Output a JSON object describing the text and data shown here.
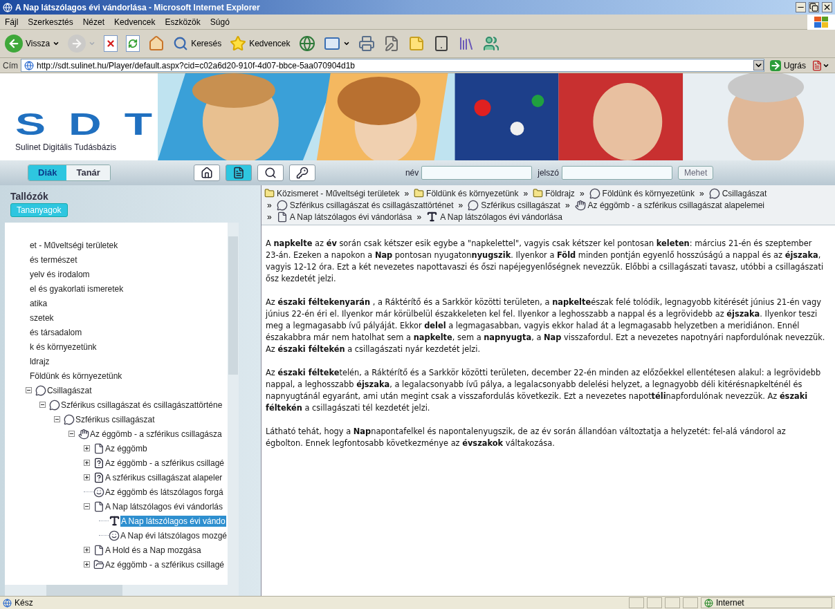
{
  "window": {
    "title": "A Nap látszólagos évi vándorlása - Microsoft Internet Explorer"
  },
  "menu": [
    "Fájl",
    "Szerkesztés",
    "Nézet",
    "Kedvencek",
    "Eszközök",
    "Súgó"
  ],
  "toolbar": [
    {
      "kind": "back",
      "label": "Vissza",
      "dropdown": true,
      "disabled": false
    },
    {
      "kind": "forward",
      "dropdown": true,
      "disabled": true
    },
    {
      "kind": "stop",
      "dropdown": false,
      "disabled": false
    },
    {
      "kind": "refresh",
      "dropdown": false,
      "disabled": false
    },
    {
      "kind": "home",
      "dropdown": false,
      "disabled": false
    },
    {
      "kind": "search",
      "label": "Keresés",
      "dropdown": false,
      "disabled": false
    },
    {
      "kind": "favorites",
      "label": "Kedvencek",
      "dropdown": false,
      "disabled": false
    },
    {
      "kind": "media",
      "dropdown": false,
      "disabled": false
    },
    {
      "kind": "mail",
      "dropdown": true,
      "disabled": false
    },
    {
      "kind": "print",
      "dropdown": false,
      "disabled": false
    },
    {
      "kind": "edit",
      "dropdown": false,
      "disabled": false
    },
    {
      "kind": "note",
      "dropdown": false,
      "disabled": false
    },
    {
      "kind": "device",
      "dropdown": false,
      "disabled": false
    },
    {
      "kind": "research",
      "dropdown": false,
      "disabled": false
    },
    {
      "kind": "messenger",
      "dropdown": false,
      "disabled": false
    }
  ],
  "address": {
    "label": "Cím",
    "value": "http://sdt.sulinet.hu/Player/default.aspx?cid=c02a6d20-910f-4d07-bbce-5aa070904d1b",
    "go": "Ugrás"
  },
  "banner": {
    "logo": "SDT",
    "subtitle": "Sulinet Digitális Tudásbázis",
    "kind": "picture"
  },
  "nav": {
    "roles": [
      {
        "label": "Diák",
        "selected": true
      },
      {
        "label": "Tanár",
        "selected": false
      }
    ],
    "tools": [
      {
        "kind": "home",
        "selected": false
      },
      {
        "kind": "page",
        "selected": true
      },
      {
        "kind": "search",
        "selected": false
      },
      {
        "kind": "key",
        "selected": false
      }
    ],
    "login": {
      "name_label": "név",
      "password_label": "jelszó",
      "submit": "Mehet"
    }
  },
  "sidebar": {
    "title": "Tallózók",
    "tab": "Tananyagok",
    "tree": [
      {
        "label": "et - Műveltségi területek",
        "selected": false,
        "children": [
          {
            "label": "és természet",
            "selected": false
          },
          {
            "label": "yelv és irodalom",
            "selected": false
          },
          {
            "label": "el és gyakorlati ismeretek",
            "selected": false
          },
          {
            "label": "atika",
            "selected": false
          },
          {
            "label": "szetek",
            "selected": false
          },
          {
            "label": "és társadalom",
            "selected": false
          },
          {
            "label": "k és környezetünk",
            "selected": false,
            "children": [
              {
                "label": "ldrajz",
                "selected": false,
                "children": [
                  {
                    "label": "Földünk és környezetünk",
                    "selected": false,
                    "children": [
                      {
                        "label": "Csillagászat",
                        "kind": "lesson",
                        "expanded": true,
                        "selected": false,
                        "children": [
                          {
                            "label": "Szférikus csillagászat és csillagászattörténe",
                            "kind": "lesson",
                            "expanded": true,
                            "selected": false,
                            "children": [
                              {
                                "label": "Szférikus csillagászat",
                                "kind": "lesson",
                                "expanded": true,
                                "selected": false,
                                "children": [
                                  {
                                    "label": "Az éggömb - a szférikus csillagásza",
                                    "kind": "module",
                                    "expanded": true,
                                    "selected": false,
                                    "children": [
                                      {
                                        "label": "Az éggömb",
                                        "kind": "doc",
                                        "expanded": false,
                                        "selected": false
                                      },
                                      {
                                        "label": "Az éggömb - a szférikus csillagé",
                                        "kind": "quiz",
                                        "expanded": false,
                                        "selected": false
                                      },
                                      {
                                        "label": "A szférikus csillagászat alapeler",
                                        "kind": "quiz",
                                        "expanded": false,
                                        "selected": false
                                      },
                                      {
                                        "label": "Az éggömb és látszólagos forgá",
                                        "kind": "sim",
                                        "selected": false
                                      },
                                      {
                                        "label": "A Nap látszólagos évi vándorlás",
                                        "kind": "doc",
                                        "expanded": true,
                                        "selected": false,
                                        "children": [
                                          {
                                            "label": "A Nap látszólagos évi vándo",
                                            "kind": "text",
                                            "selected": true
                                          },
                                          {
                                            "label": "A Nap évi látszólagos mozgé",
                                            "kind": "sim",
                                            "selected": false
                                          }
                                        ]
                                      },
                                      {
                                        "label": "A Hold és a Nap mozgása",
                                        "kind": "doc",
                                        "expanded": false,
                                        "selected": false
                                      },
                                      {
                                        "label": "Az éggömb - a szférikus csillagé",
                                        "kind": "media",
                                        "expanded": false,
                                        "selected": false
                                      }
                                    ]
                                  }
                                ]
                              }
                            ]
                          }
                        ]
                      }
                    ]
                  }
                ]
              }
            ]
          }
        ]
      }
    ]
  },
  "breadcrumb": [
    [
      {
        "kind": "folder",
        "label": "Közismeret - Műveltségi területek"
      },
      {
        "kind": "folder",
        "sep": "»",
        "label": "Földünk és környezetünk"
      },
      {
        "kind": "folder",
        "sep": "»",
        "label": "Földrajz"
      },
      {
        "kind": "lesson",
        "sep": "»",
        "label": "Földünk és környezetünk"
      },
      {
        "kind": "lesson",
        "sep": "»",
        "label": "Csillagászat"
      }
    ],
    [
      {
        "kind": "lesson",
        "sep": "»",
        "label": "Szférikus csillagászat és csillagászattörténet"
      },
      {
        "kind": "lesson",
        "sep": "»",
        "label": "Szférikus csillagászat"
      },
      {
        "kind": "module",
        "sep": "»",
        "label": "Az éggömb - a szférikus csillagászat alapelemei"
      }
    ],
    [
      {
        "kind": "doc",
        "sep": "»",
        "label": "A Nap látszólagos évi vándorlása"
      },
      {
        "kind": "text",
        "sep": "»",
        "label": "A Nap látszólagos évi vándorlása"
      }
    ]
  ],
  "content": [
    "A **napkelte** az **év** során csak kétszer esik egybe a \"napkelettel\", vagyis csak kétszer kel pontosan **keleten**: március 21-én és szeptember 23-án. Ezeken a napokon a **Nap** pontosan nyugaton**nyugszik**. Ilyenkor a **Föld** minden pontján egyenlő hosszúságú a nappal és az **éjszaka**, vagyis 12-12 óra. Ezt a két nevezetes napottavaszi és őszi napéjegyenlőségnek nevezzük. Előbbi a csillagászati tavasz, utóbbi a csillagászati ősz kezdetét jelzi.",
    "Az **északi féltekenyarán** , a Ráktérítő és a Sarkkör közötti területen, a **napkelte**észak felé tolódik, legnagyobb kitérését június 21-én vagy június 22-én éri el. Ilyenkor már körülbelül északkeleten kel fel. Ilyenkor a leghosszabb a nappal és a legrövidebb az **éjszaka**. Ilyenkor teszi meg a legmagasabb ívű pályáját. Ekkor **delel** a legmagasabban, vagyis ekkor halad át a legmagasabb helyzetben a meridiánon. Ennél északabbra már nem hatolhat sem a **napkelte**, sem a **napnyugta**, a **Nap** visszafordul. Ezt a nevezetes napotnyári napfordulónak nevezzük. Az **északi féltekén** a csillagászati nyár kezdetét jelzi.",
    "Az **északi félteke**telén, a Ráktérítő és a Sarkkör közötti területen, december 22-én minden az előzőekkel ellentétesen alakul: a legrövidebb nappal, a leghosszabb **éjszaka**, a legalacsonyabb ívű pálya, a legalacsonyabb delelési helyzet, a legnagyobb déli kitérésnapkelténél és napnyugtánál egyaránt, ami után megint csak a visszafordulás következik. Ezt a nevezetes napot**téli**napfordulónak nevezzük. Az **északi féltekén** a csillagászati tél kezdetét jelzi.",
    "Látható tehát, hogy a **Nap**napontafelkel és napontalenyugszik, de az év során állandóan változtatja a helyzetét: fel-alá vándorol az égbolton. Ennek legfontosabb következménye az **évszakok** váltakozása."
  ],
  "status_bar": {
    "text": "Kész",
    "zone": "Internet"
  }
}
